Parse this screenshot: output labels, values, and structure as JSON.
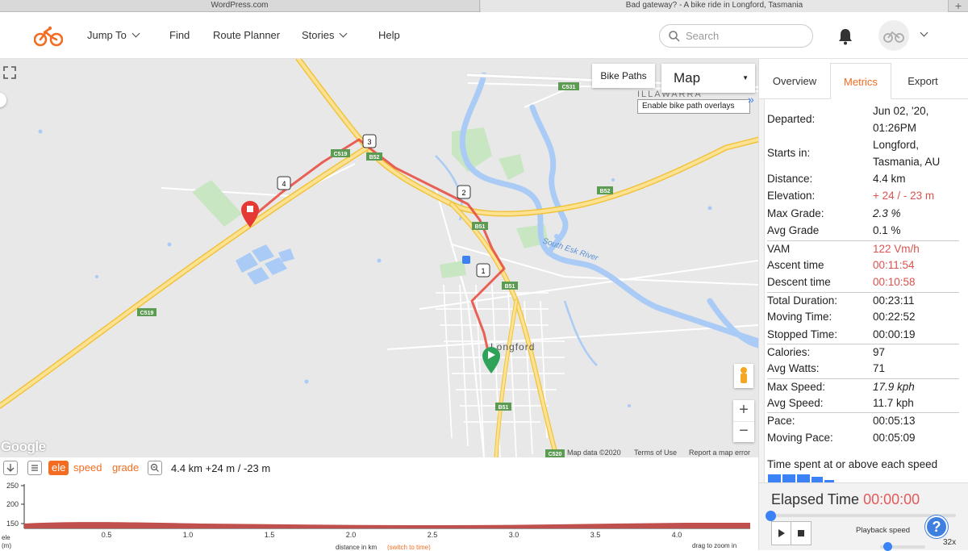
{
  "browser_tabs": [
    "WordPress.com",
    "Bad gateway? - A bike ride in Longford, Tasmania"
  ],
  "nav": {
    "items": [
      "Jump To",
      "Find",
      "Route Planner",
      "Stories",
      "Help"
    ],
    "search_placeholder": "Search"
  },
  "map": {
    "bike_paths_label": "Bike Paths",
    "map_type": "Map",
    "tooltip": "Enable bike path overlays",
    "town_label": "Longford",
    "suburb_label": "ILLAWARRA",
    "river_label": "South Esk River",
    "road_labels": [
      "C531",
      "C519",
      "B52",
      "B52",
      "B51",
      "B51",
      "B51",
      "C519",
      "C520"
    ],
    "waypoints": [
      "1",
      "2",
      "3",
      "4"
    ],
    "attribution": [
      "Map data ©2020",
      "Terms of Use",
      "Report a map error"
    ],
    "google_label": "Google"
  },
  "elevation": {
    "tabs": [
      "ele",
      "speed",
      "grade"
    ],
    "summary": "4.4 km +24 m / -23 m",
    "y_ticks": [
      "250",
      "200",
      "150"
    ],
    "y_label": [
      "ele",
      "(m)"
    ],
    "x_ticks": [
      "0.5",
      "1.0",
      "1.5",
      "2.0",
      "2.5",
      "3.0",
      "3.5",
      "4.0"
    ],
    "x_label": "distance in km",
    "x_switch": "(switch to time)",
    "drag_hint": "drag to zoom in"
  },
  "sidebar": {
    "tabs": [
      "Overview",
      "Metrics",
      "Export"
    ],
    "active_tab": "Metrics",
    "metrics": {
      "departed_label": "Departed:",
      "departed_value": [
        "Jun 02, '20,",
        "01:26PM"
      ],
      "starts_label": "Starts in:",
      "starts_value": [
        "Longford,",
        "Tasmania, AU"
      ],
      "rows": [
        {
          "label": "Distance:",
          "value": "4.4 km"
        },
        {
          "label": "Elevation:",
          "value": "+ 24 / - 23 m"
        },
        {
          "label": "Max Grade:",
          "value": "2.3 %"
        },
        {
          "label": "Avg Grade",
          "value": "0.1 %"
        },
        {
          "label": "VAM",
          "value": "122 Vm/h"
        },
        {
          "label": "Ascent time",
          "value": "00:11:54"
        },
        {
          "label": "Descent time",
          "value": "00:10:58"
        },
        {
          "label": "Total Duration:",
          "value": "00:23:11"
        },
        {
          "label": "Moving Time:",
          "value": "00:22:52"
        },
        {
          "label": "Stopped Time:",
          "value": "00:00:19"
        },
        {
          "label": "Calories:",
          "value": "97"
        },
        {
          "label": "Avg Watts:",
          "value": "71"
        },
        {
          "label": "Max Speed:",
          "value": "17.9 kph"
        },
        {
          "label": "Avg Speed:",
          "value": "11.7 kph"
        },
        {
          "label": "Pace:",
          "value": "00:05:13"
        },
        {
          "label": "Moving Pace:",
          "value": "00:05:09"
        }
      ],
      "time_spent_label": "Time spent at or above each speed"
    },
    "playback": {
      "elapsed_label": "Elapsed Time",
      "elapsed_value": "00:00:00",
      "speed_label": "Playback speed",
      "speed_value": "32x",
      "help": "?"
    }
  },
  "colors": {
    "accent": "#f26c22",
    "route": "#e8463c",
    "link_blue": "#3b82f6"
  }
}
